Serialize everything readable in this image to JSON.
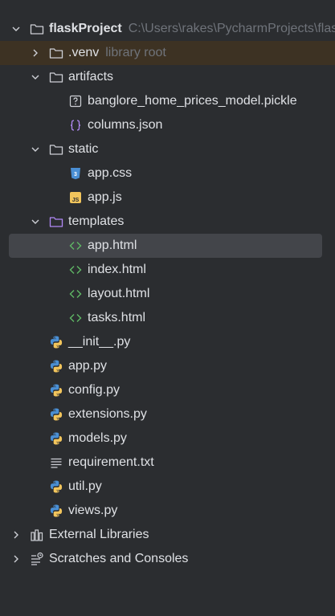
{
  "project": {
    "name": "flaskProject",
    "path": "C:\\Users\\rakes\\PycharmProjects\\flaskProject"
  },
  "venv": {
    "name": ".venv",
    "hint": "library root"
  },
  "artifacts": {
    "name": "artifacts",
    "files": [
      "banglore_home_prices_model.pickle",
      "columns.json"
    ]
  },
  "static": {
    "name": "static",
    "files": [
      "app.css",
      "app.js"
    ]
  },
  "templates": {
    "name": "templates",
    "files": [
      "app.html",
      "index.html",
      "layout.html",
      "tasks.html"
    ]
  },
  "root_files": [
    "__init__.py",
    "app.py",
    "config.py",
    "extensions.py",
    "models.py",
    "requirement.txt",
    "util.py",
    "views.py"
  ],
  "external_libraries": "External Libraries",
  "scratches": "Scratches and Consoles",
  "colors": {
    "background": "#2b2d30",
    "selection": "#43454a",
    "venv_highlight": "#3d3223",
    "text": "#dfe1e5",
    "hint": "#6f737a",
    "folder_outline": "#ced0d6",
    "templates_folder": "#b189f5",
    "html_icon": "#5fb865",
    "python_blue": "#4a8fd4",
    "python_yellow": "#f2c55c"
  }
}
